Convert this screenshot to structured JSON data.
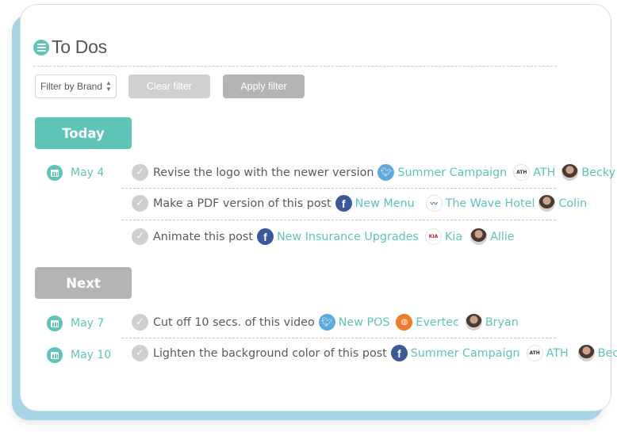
{
  "header": {
    "title": "To Dos",
    "icon": "list-icon"
  },
  "filters": {
    "brand_select": {
      "selected": "Filter by Brand",
      "icon": "sort-arrows-icon"
    },
    "clear_label": "Clear filter",
    "apply_label": "Apply filter"
  },
  "colors": {
    "accent": "#5ec4b8",
    "muted_button": "#b3b4b6",
    "disabled_button": "#cfd0d2",
    "card_back": "#a6d5e6"
  },
  "sections": [
    {
      "label": "Today",
      "groups": [
        {
          "date": "May 4",
          "tasks": [
            {
              "text": "Revise the logo with the newer version",
              "network": "twitter",
              "campaign": "Summer Campaign",
              "brand": "ATH",
              "assignee": "Becky"
            },
            {
              "text": "Make a PDF version of this post",
              "network": "facebook",
              "campaign": "New Menu",
              "brand": "The Wave Hotel",
              "assignee": "Colin"
            },
            {
              "text": "Animate this post",
              "network": "facebook",
              "campaign": "New Insurance Upgrades",
              "brand": "Kia",
              "assignee": "Allie"
            }
          ]
        }
      ]
    },
    {
      "label": "Next",
      "groups": [
        {
          "date": "May 7",
          "tasks": [
            {
              "text": "Cut off 10 secs. of this video",
              "network": "twitter",
              "campaign": "New POS",
              "brand": "Evertec",
              "assignee": "Bryan"
            }
          ]
        },
        {
          "date": "May 10",
          "tasks": [
            {
              "text": "Lighten the background color of this post",
              "network": "facebook",
              "campaign": "Summer Campaign",
              "brand": "ATH",
              "assignee": "Becky"
            }
          ]
        }
      ]
    }
  ],
  "brand_logo_text": {
    "ATH": "ATH",
    "The Wave Hotel": "〰",
    "Kia": "KIA",
    "Evertec": "◍"
  }
}
